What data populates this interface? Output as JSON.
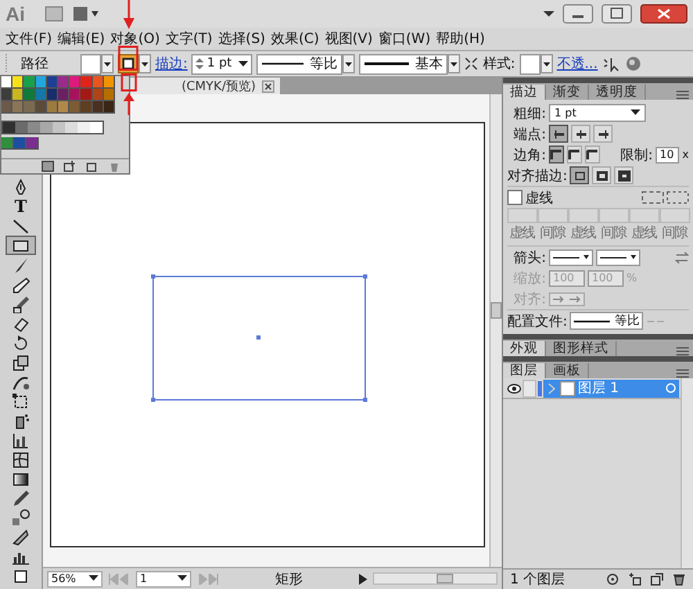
{
  "app": {
    "logo": "Ai"
  },
  "menu": [
    "文件(F)",
    "编辑(E)",
    "对象(O)",
    "文字(T)",
    "选择(S)",
    "效果(C)",
    "视图(V)",
    "窗口(W)",
    "帮助(H)"
  ],
  "control_bar": {
    "object_type": "路径",
    "stroke_link": "描边:",
    "stroke_weight": "1 pt",
    "profile": "等比",
    "brush": "基本",
    "style_label": "样式:",
    "opacity_link": "不透..."
  },
  "swatch_rows": [
    [
      {
        "color": "#ffffff"
      },
      {
        "color": "#f7e21a"
      },
      {
        "color": "#1aa04a"
      },
      {
        "color": "#21a6df"
      },
      {
        "color": "#1d3f94"
      },
      {
        "color": "#9c2a8c"
      },
      {
        "color": "#e0197d"
      },
      {
        "color": "#e2231a"
      },
      {
        "color": "#e9541f"
      },
      {
        "color": "#f29400"
      }
    ],
    [
      {
        "color": "#3d3d3d"
      },
      {
        "color": "#c9b71f"
      },
      {
        "color": "#0f7a3a"
      },
      {
        "color": "#1478a8"
      },
      {
        "color": "#192d6b"
      },
      {
        "color": "#6c1f63"
      },
      {
        "color": "#a8125c"
      },
      {
        "color": "#a51914"
      },
      {
        "color": "#b04416"
      },
      {
        "color": "#b56f00"
      }
    ],
    [
      {
        "color": "#6a5a4a"
      },
      {
        "color": "#8c7556"
      },
      {
        "color": "#7a6a50"
      },
      {
        "color": "#5c4a3a"
      },
      {
        "color": "#9d7a3f"
      },
      {
        "color": "#b0894a"
      },
      {
        "color": "#7d5b34"
      },
      {
        "color": "#5e3f22"
      },
      {
        "color": "#4a3020"
      },
      {
        "color": "#3a2516"
      }
    ],
    [
      {
        "color": "#303030"
      },
      {
        "color": "#6b6b6b"
      },
      {
        "color": "#8a8a8a"
      },
      {
        "color": "#a8a8a8"
      },
      {
        "color": "#c4c4c4"
      },
      {
        "color": "#dcdcdc"
      },
      {
        "color": "#f0f0f0"
      },
      {
        "color": "#ffffff"
      }
    ],
    [
      {
        "color": "#2f8f3f"
      },
      {
        "color": "#1d4fa0"
      },
      {
        "color": "#7a2f8f"
      }
    ]
  ],
  "document": {
    "tab": "(CMYK/预览)"
  },
  "tools": [
    {
      "kind": "pen",
      "selected": false
    },
    {
      "kind": "type",
      "label": "T",
      "selected": false
    },
    {
      "kind": "line",
      "selected": false
    },
    {
      "kind": "rectangle",
      "selected": true
    },
    {
      "kind": "brush",
      "selected": false
    },
    {
      "kind": "pencil",
      "selected": false
    },
    {
      "kind": "blob",
      "selected": false
    },
    {
      "kind": "eraser",
      "selected": false
    },
    {
      "kind": "rotate",
      "selected": false
    },
    {
      "kind": "scale",
      "selected": false
    },
    {
      "kind": "warp",
      "selected": false
    },
    {
      "kind": "transform",
      "selected": false
    },
    {
      "kind": "sprayer",
      "selected": false
    },
    {
      "kind": "graph",
      "selected": false
    },
    {
      "kind": "mesh",
      "selected": false
    },
    {
      "kind": "gradient",
      "selected": false
    },
    {
      "kind": "eyedropper",
      "selected": false
    },
    {
      "kind": "blend",
      "selected": false
    },
    {
      "kind": "slice",
      "selected": false
    },
    {
      "kind": "chart",
      "selected": false
    },
    {
      "kind": "square",
      "selected": false
    }
  ],
  "status_bar": {
    "zoom": "56%",
    "page": "1",
    "status": "矩形"
  },
  "stroke_panel": {
    "tabs": [
      {
        "label": "描边",
        "selected": true
      },
      {
        "label": "渐变",
        "selected": false
      },
      {
        "label": "透明度",
        "selected": false
      }
    ],
    "weight_label": "粗细:",
    "weight": "1 pt",
    "cap_label": "端点:",
    "caps": [
      {
        "selected": true
      },
      {
        "selected": false
      },
      {
        "selected": false
      }
    ],
    "corner_label": "边角:",
    "corners": [
      {
        "selected": true
      },
      {
        "selected": false
      },
      {
        "selected": false
      }
    ],
    "limit_label": "限制:",
    "limit": "10",
    "limit_unit": "x",
    "align_label": "对齐描边:",
    "aligns": [
      {
        "selected": true
      },
      {
        "selected": false
      },
      {
        "selected": false
      }
    ],
    "dashed": {
      "label": "虚线",
      "checked": false
    },
    "dash_labels": [
      "虚线",
      "间隙",
      "虚线",
      "间隙",
      "虚线",
      "间隙"
    ],
    "arrow_label": "箭头:",
    "scale_label": "缩放:",
    "scale_start": "100",
    "scale_end": "100",
    "scale_unit": "%",
    "arrow_align_label": "对齐:",
    "profile_label": "配置文件:",
    "profile": "等比"
  },
  "appearance_tabs": [
    {
      "label": "外观",
      "selected": true
    },
    {
      "label": "图形样式",
      "selected": false
    }
  ],
  "layers_panel": {
    "tabs": [
      {
        "label": "图层",
        "selected": true
      },
      {
        "label": "画板",
        "selected": false
      }
    ],
    "layers": [
      {
        "name": "图层 1",
        "selected": true,
        "visible": true
      }
    ],
    "count": "1 个图层"
  }
}
